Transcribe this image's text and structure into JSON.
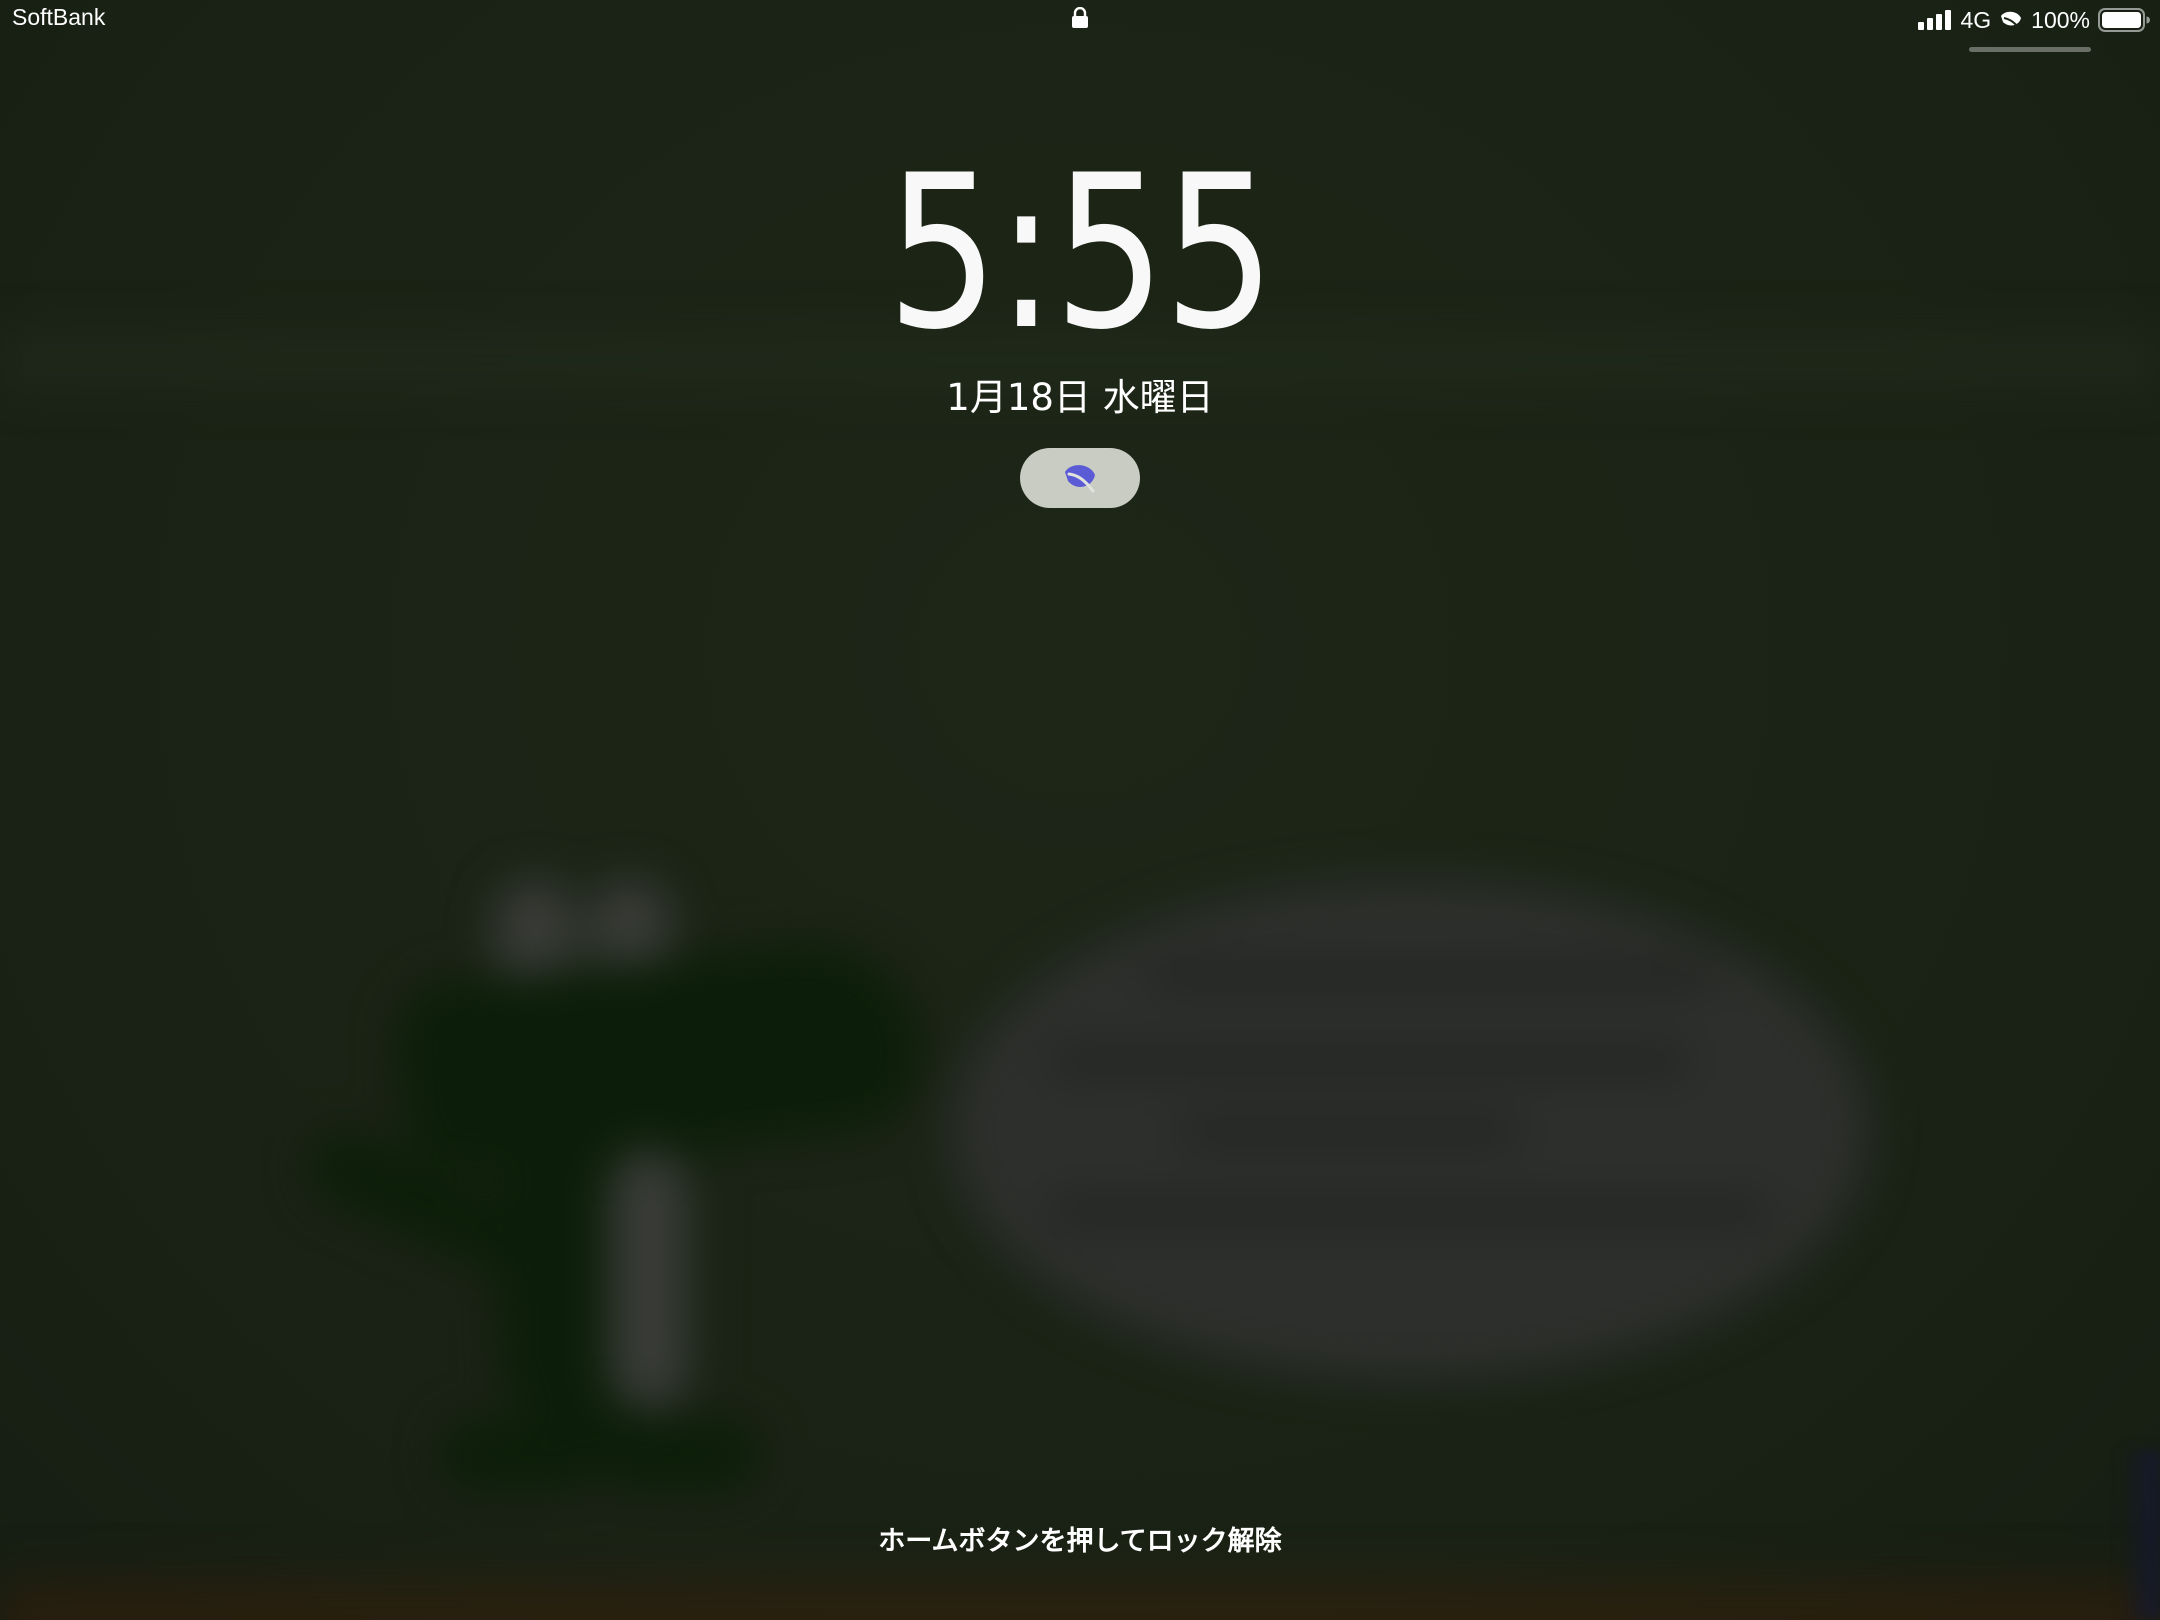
{
  "status_bar": {
    "carrier": "SoftBank",
    "network": "4G",
    "battery": "100%",
    "battery_level": 1.0,
    "icons": [
      "lock-icon",
      "signal-icon",
      "leaf-icon",
      "battery-icon"
    ]
  },
  "lock_screen": {
    "time": "5:55",
    "date": "1月18日 水曜日",
    "focus_icon": "leaf-icon",
    "unlock_hint": "ホームボタンを押してロック解除"
  },
  "colors": {
    "background": "#1b2416",
    "focus_pill": "#e1e4dc",
    "focus_leaf": "#5b5bd6",
    "text": "#ffffff"
  }
}
